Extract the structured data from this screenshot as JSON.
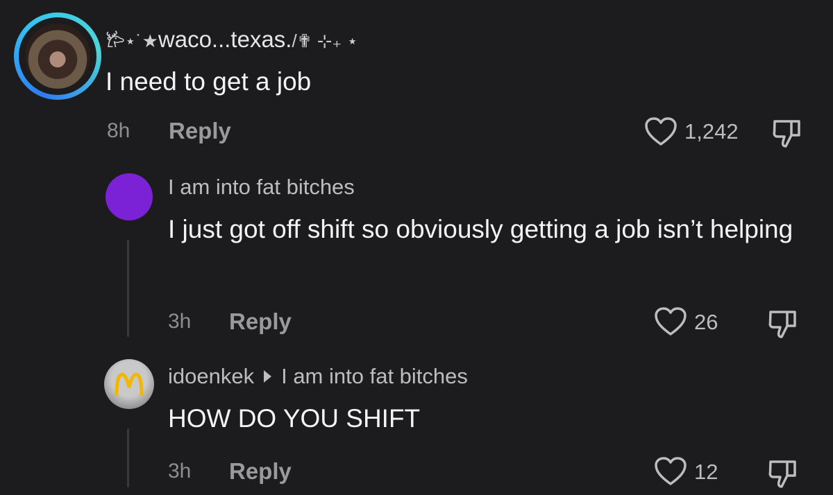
{
  "comments": [
    {
      "username": "waco...texas.",
      "username_prefix": "𐂂⋆˙★",
      "username_suffix": "/✟ ⊹₊ ⋆",
      "text": "I need to get a job",
      "time": "8h",
      "reply_label": "Reply",
      "likes": "1,242"
    },
    {
      "username": "I am into fat bitches",
      "text": "I just got off shift so obviously getting a job isn’t helping",
      "time": "3h",
      "reply_label": "Reply",
      "likes": "26"
    },
    {
      "username": "idoenkek",
      "reply_to": "I am into fat bitches",
      "text": "HOW DO YOU SHIFT",
      "time": "3h",
      "reply_label": "Reply",
      "likes": "12"
    }
  ],
  "colors": {
    "background": "#1c1c1e",
    "ring_gradient_start": "#2f7bf0",
    "ring_gradient_end": "#4ed6d6",
    "purple_avatar": "#7b22d6",
    "mcdonalds_yellow": "#f2b705"
  },
  "icons": [
    "heart-icon",
    "dislike-icon",
    "mcdonalds-logo"
  ]
}
